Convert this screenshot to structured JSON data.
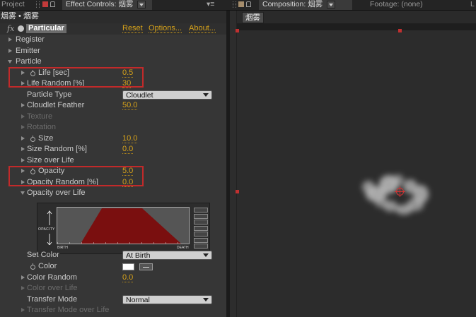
{
  "tabs": {
    "project": "Project",
    "effect_controls": "Effect Controls: 烟雾",
    "composition": "Composition: 烟雾",
    "footage": "Footage: (none)",
    "cut_tab": "L"
  },
  "breadcrumb": "烟雾 • 烟雾",
  "effect": {
    "fx": "fx",
    "name": "Particular",
    "reset": "Reset",
    "options": "Options...",
    "about": "About..."
  },
  "rows": {
    "register": "Register",
    "emitter": "Emitter",
    "particle": "Particle",
    "life_label": "Life [sec]",
    "life_value": "0.5",
    "life_random_label": "Life Random [%]",
    "life_random_value": "30",
    "particle_type_label": "Particle Type",
    "particle_type_value": "Cloudlet",
    "cloudlet_feather_label": "Cloudlet Feather",
    "cloudlet_feather_value": "50.0",
    "texture": "Texture",
    "rotation": "Rotation",
    "size_label": "Size",
    "size_value": "10.0",
    "size_random_label": "Size Random [%]",
    "size_random_value": "0.0",
    "size_over_life": "Size over Life",
    "opacity_label": "Opacity",
    "opacity_value": "5.0",
    "opacity_random_label": "Opacity Random [%]",
    "opacity_random_value": "0.0",
    "opacity_over_life": "Opacity over Life",
    "set_color_label": "Set Color",
    "set_color_value": "At Birth",
    "color_label": "Color",
    "color_random_label": "Color Random",
    "color_random_value": "0.0",
    "color_over_life": "Color over Life",
    "transfer_mode_label": "Transfer Mode",
    "transfer_mode_value": "Normal",
    "transfer_mode_over_life": "Transfer Mode over Life"
  },
  "graph": {
    "y_label": "OPACITY",
    "birth": "BIRTH",
    "death": "DEATH",
    "curve_color": "#7a0f0f"
  },
  "composition": {
    "comp_tab": "烟雾"
  },
  "colors": {
    "accent_value": "#d6a21a",
    "highlight_box": "#c22a2a",
    "particle_color": "#ffffff"
  }
}
